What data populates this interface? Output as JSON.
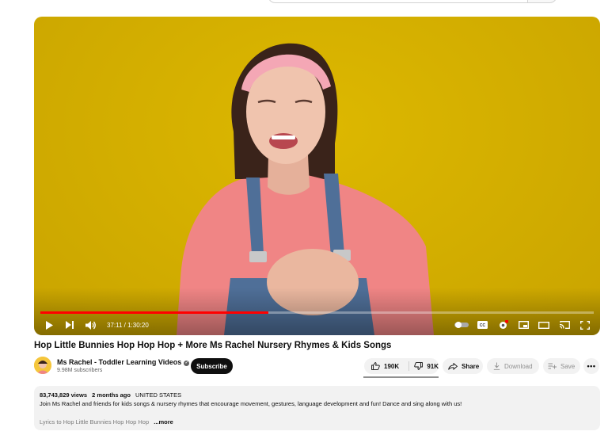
{
  "video": {
    "title": "Hop Little Bunnies Hop Hop Hop + More Ms Rachel Nursery Rhymes & Kids Songs",
    "time": "37:11 / 1:30:20",
    "progress_fraction": 0.412,
    "background_color": "#d6b100",
    "progress_color": "#ff0000"
  },
  "channel": {
    "name": "Ms Rachel - Toddler Learning Videos",
    "subscribers": "9.98M subscribers",
    "subscribe_label": "Subscribe",
    "verified_icon": "verified-check-icon"
  },
  "actions": {
    "like_count": "190K",
    "dislike_count": "91K",
    "share_label": "Share",
    "download_label": "Download",
    "save_label": "Save",
    "more_label": "•••"
  },
  "description": {
    "views": "83,743,829 views",
    "age": "2 months ago",
    "location": "UNITED STATES",
    "text": "Join Ms Rachel and friends for kids songs & nursery rhymes that encourage movement, gestures, language development and fun! Dance and sing along with us!",
    "lyrics_preview": "Lyrics to Hop Little Bunnies Hop Hop Hop",
    "more_label": "...more"
  }
}
